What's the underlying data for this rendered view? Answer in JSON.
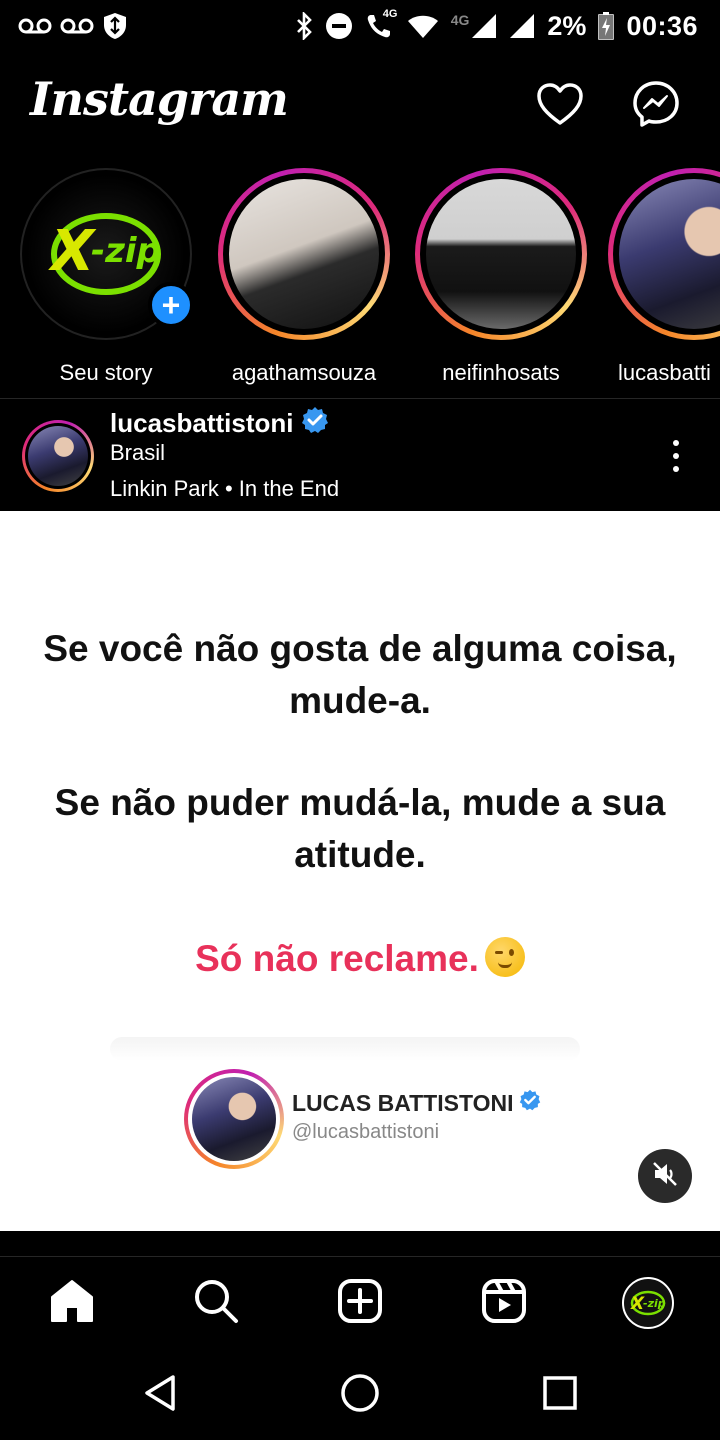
{
  "status_bar": {
    "network_label": "4G",
    "call_label": "4G",
    "battery": "2%",
    "time": "00:36"
  },
  "header": {
    "logo": "Instagram",
    "icons": [
      "heart-icon",
      "messenger-icon"
    ]
  },
  "stories": [
    {
      "name": "Seu story",
      "own": true,
      "avatar_logo": "X-zip"
    },
    {
      "name": "agathamsouza",
      "own": false
    },
    {
      "name": "neifinhosats",
      "own": false
    },
    {
      "name": "lucasbatti",
      "own": false
    }
  ],
  "post": {
    "username": "lucasbattistoni",
    "verified": true,
    "location": "Brasil",
    "music": "Linkin Park • In the End",
    "quote_line1": "Se você não gosta de alguma coisa, mude-a.",
    "quote_line2": "Se não puder mudá-la, mude a sua atitude.",
    "quote_line3": "Só não reclame.",
    "card_name": "LUCAS BATTISTONI",
    "card_handle": "@lucasbattistoni",
    "accent_color": "#e8315a"
  },
  "bottom_nav": {
    "items": [
      "home-icon",
      "search-icon",
      "add-post-icon",
      "reels-icon",
      "profile-avatar"
    ],
    "profile_logo": "X-zip"
  },
  "system_nav": [
    "back-icon",
    "home-circle-icon",
    "recents-icon"
  ]
}
